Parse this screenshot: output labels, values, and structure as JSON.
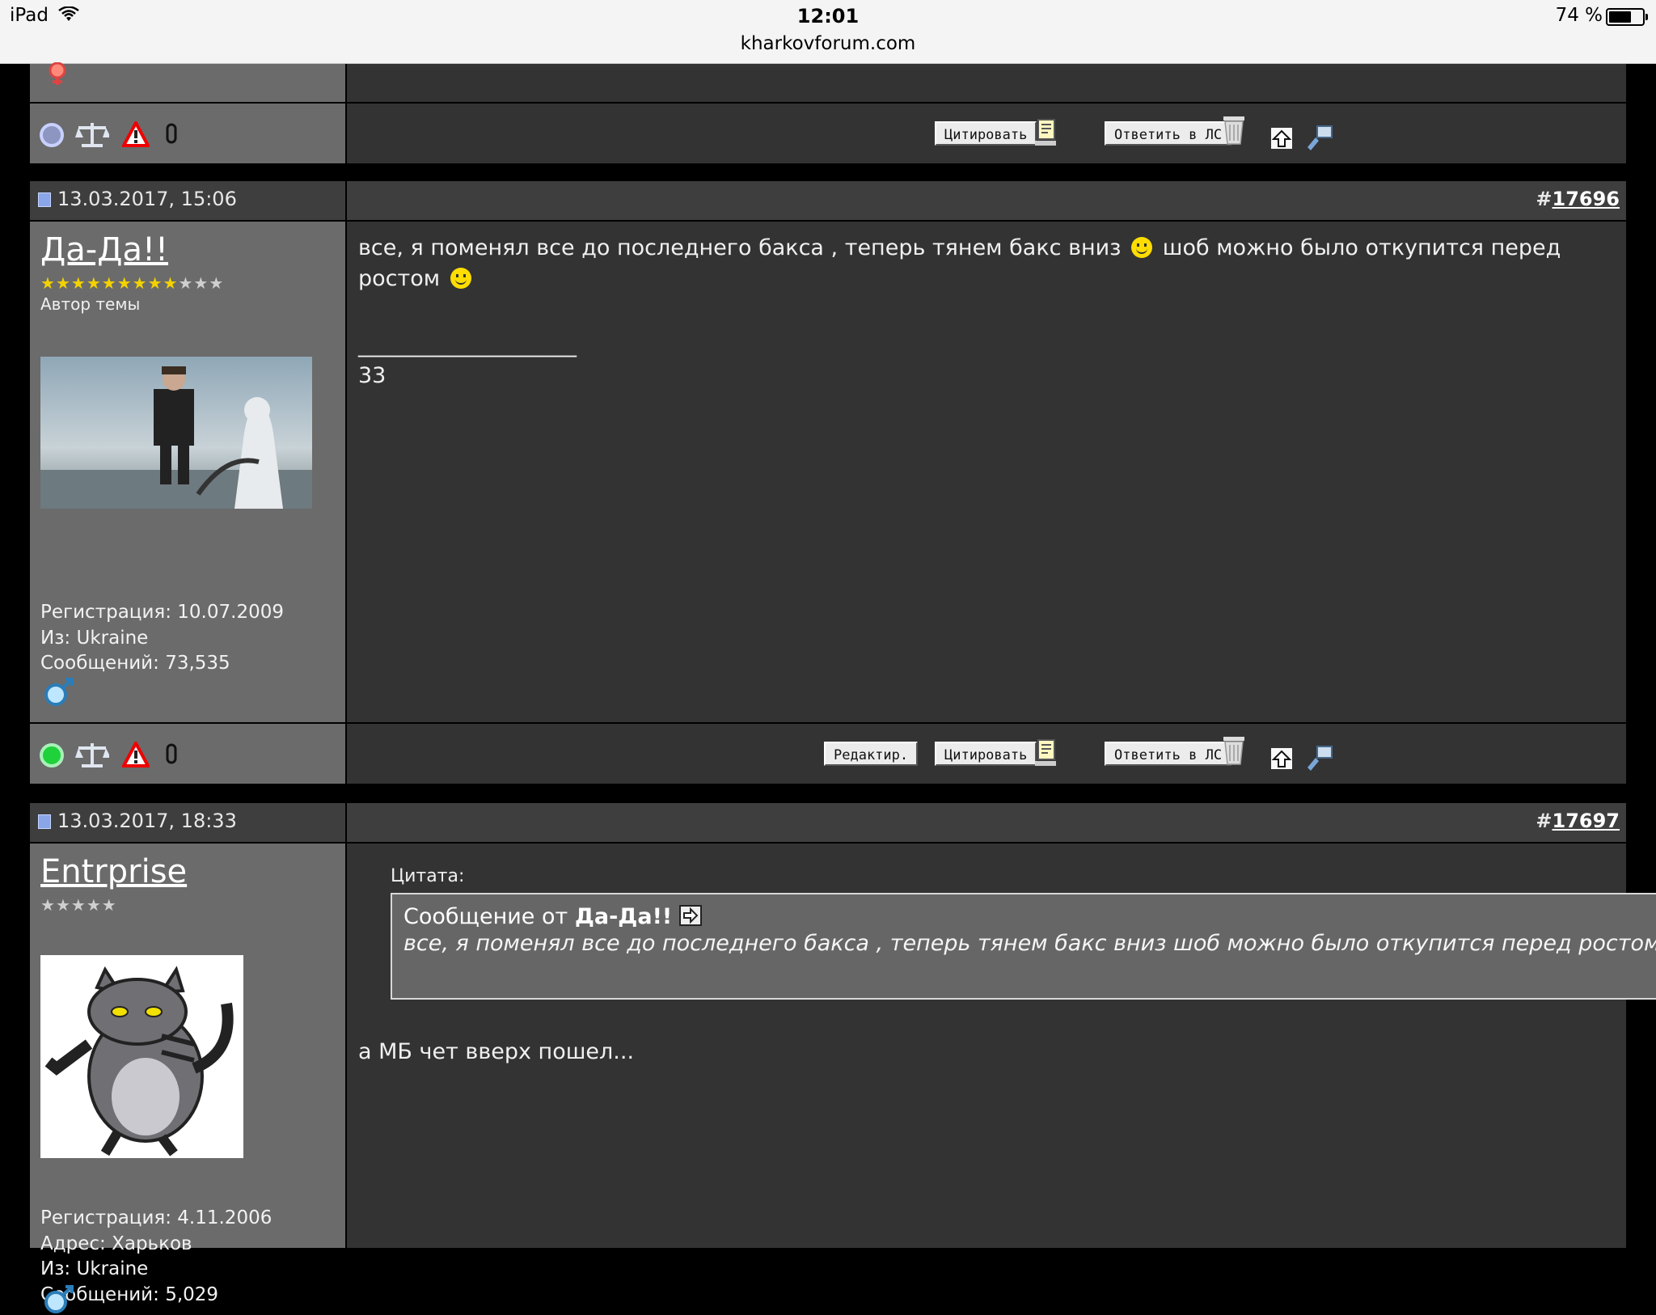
{
  "status_bar": {
    "device": "iPad",
    "time": "12:01",
    "url": "kharkovforum.com",
    "battery": "74 %",
    "battery_level": 0.74
  },
  "post_top": {
    "buttons": {
      "quote": "Цитировать",
      "reply_pm": "Ответить в ЛС"
    }
  },
  "post_17696": {
    "date": "13.03.2017, 15:06",
    "number_prefix": "#",
    "number": "17696",
    "username": "Да-Да!!",
    "stars_on": 9,
    "stars_total": 12,
    "user_title": "Автор темы",
    "registration": "Регистрация: 10.07.2009",
    "from": "Из: Ukraine",
    "posts": "Сообщений: 73,535",
    "message_part1": "все, я поменял все до последнего бакса , теперь тянем бакс вниз",
    "message_part2": "шоб можно было откупится перед",
    "message_part3": "ростом",
    "signature_line": "____________________",
    "signature": "33",
    "buttons": {
      "edit": "Редактир.",
      "quote": "Цитировать",
      "reply_pm": "Ответить в ЛС"
    }
  },
  "post_17697": {
    "date": "13.03.2017, 18:33",
    "number_prefix": "#",
    "number": "17697",
    "username": "Entrprise",
    "stars_on": 0,
    "stars_total": 5,
    "registration": "Регистрация: 4.11.2006",
    "address": "Адрес: Харьков",
    "from": "Из: Ukraine",
    "posts": "Сообщений: 5,029",
    "quote_label": "Цитата:",
    "quote_from_prefix": "Сообщение от",
    "quote_author": "Да-Да!!",
    "quote_text": "все, я поменял все до последнего бакса , теперь тянем бакс вниз шоб можно было откупится перед ростом",
    "message": "а МБ чет вверх пошел..."
  }
}
